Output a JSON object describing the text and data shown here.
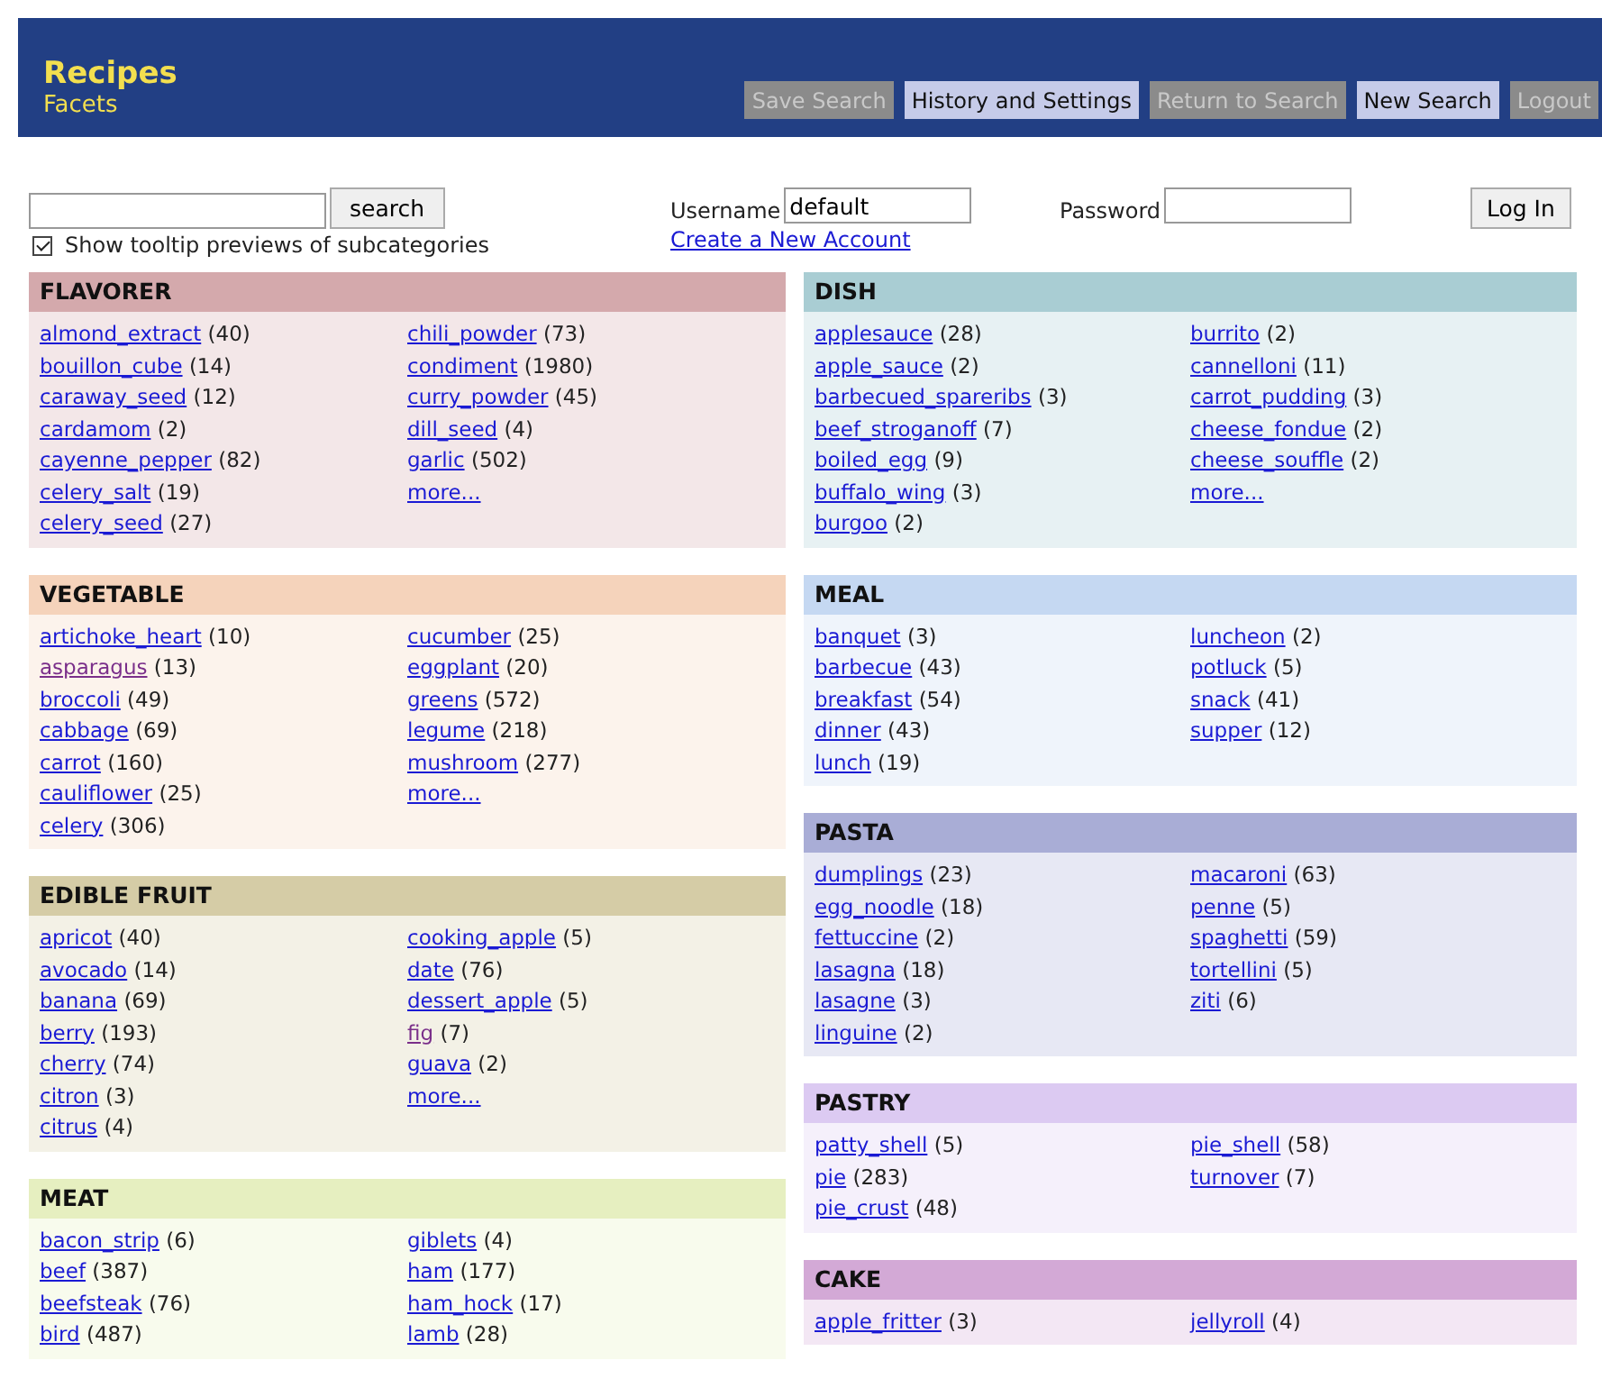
{
  "header": {
    "title": "Recipes",
    "subtitle": "Facets",
    "buttons": [
      {
        "label": "Save Search",
        "disabled": true
      },
      {
        "label": "History and Settings",
        "disabled": false
      },
      {
        "label": "Return to Search",
        "disabled": true
      },
      {
        "label": "New Search",
        "disabled": false
      },
      {
        "label": "Logout",
        "disabled": true
      }
    ]
  },
  "search": {
    "button": "search",
    "tooltip_option": {
      "label": "Show tooltip previews of subcategories",
      "checked": true
    }
  },
  "login": {
    "username_label": "Username",
    "username": "default",
    "create_account": "Create a New Account",
    "password_label": "Password",
    "button": "Log In"
  },
  "columns": [
    [
      {
        "title": "FLAVORER",
        "color": "#d4a9ac",
        "more": "more...",
        "columns": [
          [
            {
              "name": "almond_extract",
              "count": "(40)",
              "visited": false
            },
            {
              "name": "bouillon_cube",
              "count": "(14)",
              "visited": false
            },
            {
              "name": "caraway_seed",
              "count": "(12)",
              "visited": false
            },
            {
              "name": "cardamom",
              "count": "(2)",
              "visited": false
            },
            {
              "name": "cayenne_pepper",
              "count": "(82)",
              "visited": false
            },
            {
              "name": "celery_salt",
              "count": "(19)",
              "visited": false
            },
            {
              "name": "celery_seed",
              "count": "(27)",
              "visited": false
            }
          ],
          [
            {
              "name": "chili_powder",
              "count": "(73)",
              "visited": false
            },
            {
              "name": "condiment",
              "count": "(1980)",
              "visited": false
            },
            {
              "name": "curry_powder",
              "count": "(45)",
              "visited": false
            },
            {
              "name": "dill_seed",
              "count": "(4)",
              "visited": false
            },
            {
              "name": "garlic",
              "count": "(502)",
              "visited": false
            }
          ]
        ]
      },
      {
        "title": "VEGETABLE",
        "color": "#f5d3bb",
        "more": "more...",
        "columns": [
          [
            {
              "name": "artichoke_heart",
              "count": "(10)",
              "visited": false
            },
            {
              "name": "asparagus",
              "count": "(13)",
              "visited": true
            },
            {
              "name": "broccoli",
              "count": "(49)",
              "visited": false
            },
            {
              "name": "cabbage",
              "count": "(69)",
              "visited": false
            },
            {
              "name": "carrot",
              "count": "(160)",
              "visited": false
            },
            {
              "name": "cauliflower",
              "count": "(25)",
              "visited": false
            },
            {
              "name": "celery",
              "count": "(306)",
              "visited": false
            }
          ],
          [
            {
              "name": "cucumber",
              "count": "(25)",
              "visited": false
            },
            {
              "name": "eggplant",
              "count": "(20)",
              "visited": false
            },
            {
              "name": "greens",
              "count": "(572)",
              "visited": false
            },
            {
              "name": "legume",
              "count": "(218)",
              "visited": false
            },
            {
              "name": "mushroom",
              "count": "(277)",
              "visited": false
            }
          ]
        ]
      },
      {
        "title": "EDIBLE FRUIT",
        "color": "#d5cca6",
        "more": "more...",
        "columns": [
          [
            {
              "name": "apricot",
              "count": "(40)",
              "visited": false
            },
            {
              "name": "avocado",
              "count": "(14)",
              "visited": false
            },
            {
              "name": "banana",
              "count": "(69)",
              "visited": false
            },
            {
              "name": "berry",
              "count": "(193)",
              "visited": false
            },
            {
              "name": "cherry",
              "count": "(74)",
              "visited": false
            },
            {
              "name": "citron",
              "count": "(3)",
              "visited": false
            },
            {
              "name": "citrus",
              "count": "(4)",
              "visited": false
            }
          ],
          [
            {
              "name": "cooking_apple",
              "count": "(5)",
              "visited": false
            },
            {
              "name": "date",
              "count": "(76)",
              "visited": false
            },
            {
              "name": "dessert_apple",
              "count": "(5)",
              "visited": false
            },
            {
              "name": "fig",
              "count": "(7)",
              "visited": true
            },
            {
              "name": "guava",
              "count": "(2)",
              "visited": false
            }
          ]
        ]
      },
      {
        "title": "MEAT",
        "color": "#e6efc0",
        "columns": [
          [
            {
              "name": "bacon_strip",
              "count": "(6)",
              "visited": false
            },
            {
              "name": "beef",
              "count": "(387)",
              "visited": false
            },
            {
              "name": "beefsteak",
              "count": "(76)",
              "visited": false
            },
            {
              "name": "bird",
              "count": "(487)",
              "visited": false
            }
          ],
          [
            {
              "name": "giblets",
              "count": "(4)",
              "visited": false
            },
            {
              "name": "ham",
              "count": "(177)",
              "visited": false
            },
            {
              "name": "ham_hock",
              "count": "(17)",
              "visited": false
            },
            {
              "name": "lamb",
              "count": "(28)",
              "visited": false
            }
          ]
        ]
      }
    ],
    [
      {
        "title": "DISH",
        "color": "#a9cdd3",
        "more": "more...",
        "columns": [
          [
            {
              "name": "applesauce",
              "count": "(28)",
              "visited": false
            },
            {
              "name": "apple_sauce",
              "count": "(2)",
              "visited": false
            },
            {
              "name": "barbecued_spareribs",
              "count": "(3)",
              "visited": false
            },
            {
              "name": "beef_stroganoff",
              "count": "(7)",
              "visited": false
            },
            {
              "name": "boiled_egg",
              "count": "(9)",
              "visited": false
            },
            {
              "name": "buffalo_wing",
              "count": "(3)",
              "visited": false
            },
            {
              "name": "burgoo",
              "count": "(2)",
              "visited": false
            }
          ],
          [
            {
              "name": "burrito",
              "count": "(2)",
              "visited": false
            },
            {
              "name": "cannelloni",
              "count": "(11)",
              "visited": false
            },
            {
              "name": "carrot_pudding",
              "count": "(3)",
              "visited": false
            },
            {
              "name": "cheese_fondue",
              "count": "(2)",
              "visited": false
            },
            {
              "name": "cheese_souffle",
              "count": "(2)",
              "visited": false
            }
          ]
        ]
      },
      {
        "title": "MEAL",
        "color": "#c5d8f2",
        "columns": [
          [
            {
              "name": "banquet",
              "count": "(3)",
              "visited": false
            },
            {
              "name": "barbecue",
              "count": "(43)",
              "visited": false
            },
            {
              "name": "breakfast",
              "count": "(54)",
              "visited": false
            },
            {
              "name": "dinner",
              "count": "(43)",
              "visited": false
            },
            {
              "name": "lunch",
              "count": "(19)",
              "visited": false
            }
          ],
          [
            {
              "name": "luncheon",
              "count": "(2)",
              "visited": false
            },
            {
              "name": "potluck",
              "count": "(5)",
              "visited": false
            },
            {
              "name": "snack",
              "count": "(41)",
              "visited": false
            },
            {
              "name": "supper",
              "count": "(12)",
              "visited": false
            }
          ]
        ]
      },
      {
        "title": "PASTA",
        "color": "#a9add6",
        "columns": [
          [
            {
              "name": "dumplings",
              "count": "(23)",
              "visited": false
            },
            {
              "name": "egg_noodle",
              "count": "(18)",
              "visited": false
            },
            {
              "name": "fettuccine",
              "count": "(2)",
              "visited": false
            },
            {
              "name": "lasagna",
              "count": "(18)",
              "visited": false
            },
            {
              "name": "lasagne",
              "count": "(3)",
              "visited": false
            },
            {
              "name": "linguine",
              "count": "(2)",
              "visited": false
            }
          ],
          [
            {
              "name": "macaroni",
              "count": "(63)",
              "visited": false
            },
            {
              "name": "penne",
              "count": "(5)",
              "visited": false
            },
            {
              "name": "spaghetti",
              "count": "(59)",
              "visited": false
            },
            {
              "name": "tortellini",
              "count": "(5)",
              "visited": false
            },
            {
              "name": "ziti",
              "count": "(6)",
              "visited": false
            }
          ]
        ]
      },
      {
        "title": "PASTRY",
        "color": "#dccaf2",
        "columns": [
          [
            {
              "name": "patty_shell",
              "count": "(5)",
              "visited": false
            },
            {
              "name": "pie",
              "count": "(283)",
              "visited": false
            },
            {
              "name": "pie_crust",
              "count": "(48)",
              "visited": false
            }
          ],
          [
            {
              "name": "pie_shell",
              "count": "(58)",
              "visited": false
            },
            {
              "name": "turnover",
              "count": "(7)",
              "visited": false
            }
          ]
        ]
      },
      {
        "title": "CAKE",
        "color": "#d3a9d6",
        "columns": [
          [
            {
              "name": "apple_fritter",
              "count": "(3)",
              "visited": false
            }
          ],
          [
            {
              "name": "jellyroll",
              "count": "(4)",
              "visited": false
            }
          ]
        ]
      }
    ]
  ]
}
